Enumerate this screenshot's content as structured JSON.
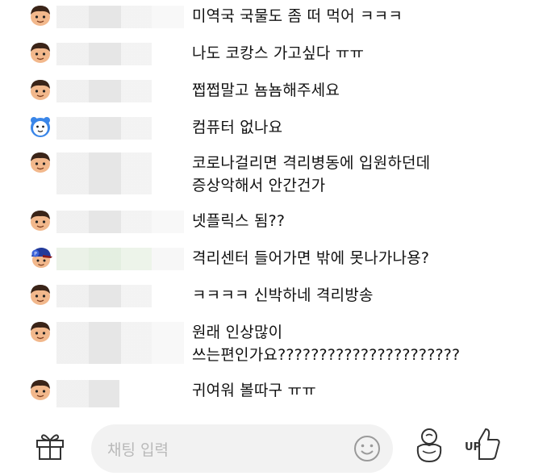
{
  "chat": {
    "messages": [
      {
        "text": "미역국 국물도 좀 떠 먹어 ㅋㅋㅋ",
        "avatar": "boy-face-icon"
      },
      {
        "text": "나도 코캉스 가고싶다 ㅠㅠ",
        "avatar": "boy-face-icon"
      },
      {
        "text": "쩝쩝말고 뇸뇸해주세요",
        "avatar": "boy-face-icon"
      },
      {
        "text": "컴퓨터 없나요",
        "avatar": "blue-bear-face-icon"
      },
      {
        "text": "코로나걸리면 격리병동에 입원하던데",
        "text2": "증상악해서 안간건가",
        "avatar": "boy-face-icon"
      },
      {
        "text": "넷플릭스 됨??",
        "avatar": "boy-face-icon"
      },
      {
        "text": "격리센터 들어가면 밖에 못나가나용?",
        "avatar": "cap-boy-face-icon"
      },
      {
        "text": "ㅋㅋㅋㅋ 신박하네 격리방송",
        "avatar": "boy-face-icon"
      },
      {
        "text": "원래 인상많이",
        "text2": "쓰는편인가요??????????????????????",
        "avatar": "boy-face-icon"
      },
      {
        "text": "귀여워 볼따구 ㅠㅠ",
        "avatar": "boy-face-icon"
      }
    ]
  },
  "input": {
    "placeholder": "채팅 입력",
    "up_label": "UP"
  },
  "icons": {
    "gift": "gift-icon",
    "emoji": "smiley-icon",
    "pot": "balloon-pot-icon",
    "thumbs_up": "thumbs-up-icon"
  }
}
